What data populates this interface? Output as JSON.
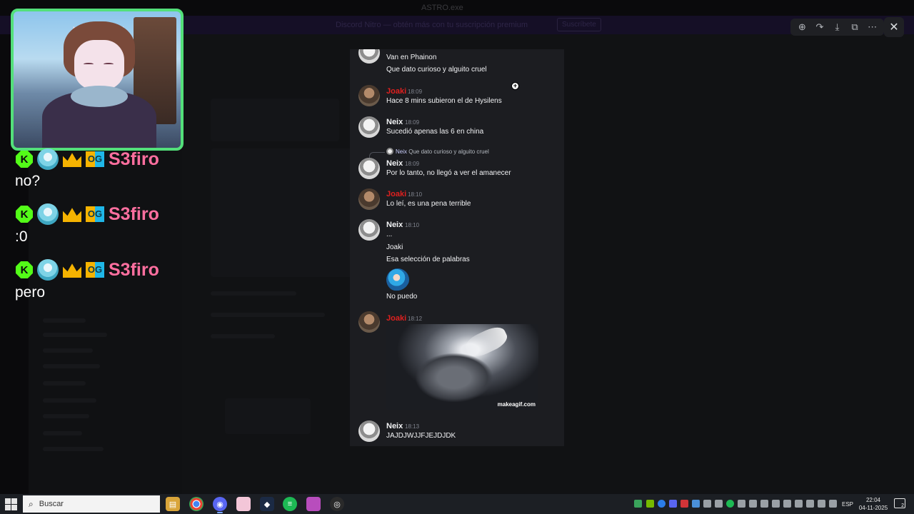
{
  "app": {
    "window_title": "ASTRO.exe",
    "banner_text": "Discord Nitro — obtén más con tu suscripción premium",
    "banner_button": "Suscríbete"
  },
  "viewer_toolbar": {
    "zoom_icon": "zoom-icon",
    "forward_icon": "forward-icon",
    "download_icon": "download-icon",
    "open_external_icon": "open-external-icon",
    "more_icon": "more-icon",
    "close_icon": "close-icon"
  },
  "chat": {
    "messages": [
      {
        "author": "",
        "time": "",
        "lines": [
          "Van en Phainon",
          "Que dato curioso y alguito cruel"
        ]
      },
      {
        "author": "Joaki",
        "time": "18:09",
        "lines": [
          "Hace 8 mins subieron el de Hysilens"
        ]
      },
      {
        "author": "Neix",
        "time": "18:09",
        "lines": [
          "Sucedió apenas las 6 en china"
        ]
      },
      {
        "author": "Neix",
        "time": "18:09",
        "reply": {
          "author": "Neix",
          "text": "Que dato curioso y alguito cruel"
        },
        "lines": [
          "Por lo tanto, no llegó a ver el amanecer"
        ]
      },
      {
        "author": "Joaki",
        "time": "18:10",
        "lines": [
          "Lo leí, es una pena terrible"
        ]
      },
      {
        "author": "Neix",
        "time": "18:10",
        "lines": [
          "...",
          "Joaki",
          "Esa selección de palabras",
          "No puedo"
        ]
      },
      {
        "author": "Joaki",
        "time": "18:12",
        "gif_watermark": "makeagif.com"
      },
      {
        "author": "Neix",
        "time": "18:13",
        "lines": [
          "JAJDJWJJFJEJDJDK"
        ]
      }
    ]
  },
  "stream_chat": [
    {
      "user": "S3firo",
      "message": "no?"
    },
    {
      "user": "S3firo",
      "message": ":0"
    },
    {
      "user": "S3firo",
      "message": "pero"
    }
  ],
  "stream_badges": {
    "kick": "K",
    "og": "OG"
  },
  "taskbar": {
    "search_placeholder": "Buscar",
    "language": "ESP",
    "time": "22:04",
    "date": "04-11-2025",
    "notifications": "2"
  },
  "colors": {
    "neix": "#f2f3f5",
    "joaki": "#e0201f",
    "stream_user": "#ff6f9f",
    "webcam_border": "#53e07a"
  }
}
